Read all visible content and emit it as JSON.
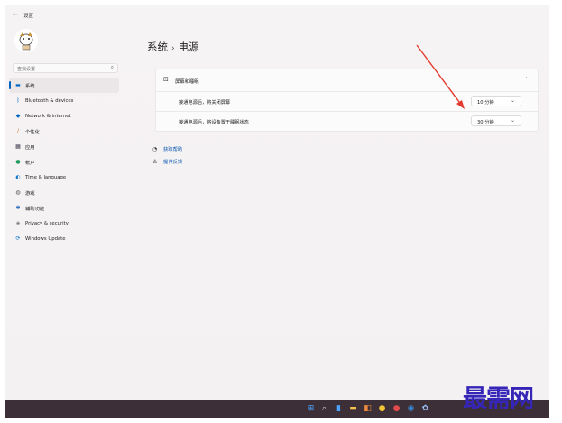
{
  "window": {
    "title": "设置"
  },
  "search": {
    "placeholder": "查找设置"
  },
  "nav": [
    {
      "label": "系统",
      "icon": "monitor-icon",
      "active": true
    },
    {
      "label": "Bluetooth & devices",
      "icon": "bluetooth-icon"
    },
    {
      "label": "Network & internet",
      "icon": "wifi-icon"
    },
    {
      "label": "个性化",
      "icon": "brush-icon"
    },
    {
      "label": "应用",
      "icon": "apps-icon"
    },
    {
      "label": "帐户",
      "icon": "person-icon"
    },
    {
      "label": "Time & language",
      "icon": "globe-clock-icon"
    },
    {
      "label": "游戏",
      "icon": "gamepad-icon"
    },
    {
      "label": "辅助功能",
      "icon": "accessibility-icon"
    },
    {
      "label": "Privacy & security",
      "icon": "shield-icon"
    },
    {
      "label": "Windows Update",
      "icon": "update-icon"
    }
  ],
  "breadcrumb": {
    "parent": "系统",
    "current": "电源"
  },
  "card": {
    "title": "屏幕和睡眠",
    "rows": [
      {
        "label": "接通电源后，将关闭屏幕",
        "value": "10 分钟"
      },
      {
        "label": "接通电源后，将设备置于睡眠状态",
        "value": "30 分钟"
      }
    ]
  },
  "links": {
    "help": "获取帮助",
    "feedback": "提供反馈"
  },
  "watermark": "最需网",
  "colors": {
    "accent": "#0067c0",
    "arrow": "#e33a2f",
    "taskbar": "#3c2f38"
  }
}
